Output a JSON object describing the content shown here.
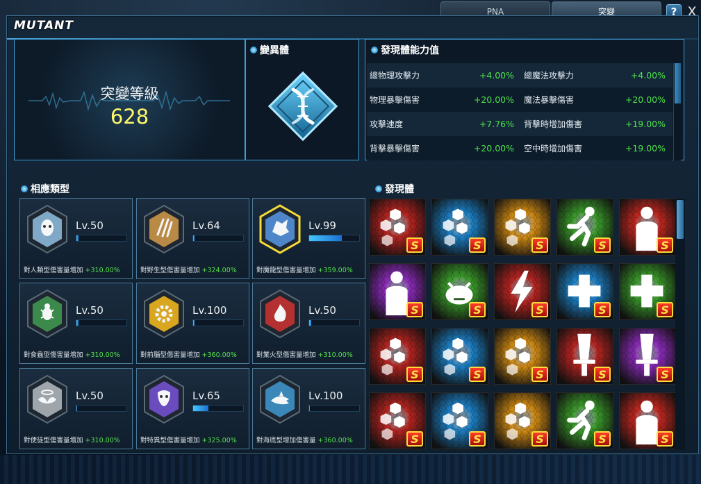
{
  "tabs": [
    {
      "label": "PNA",
      "active": false
    },
    {
      "label": "突變",
      "active": true
    }
  ],
  "help_label": "?",
  "close_label": "X",
  "window_title": "MUTANT",
  "level": {
    "label": "突變等級",
    "value": "628"
  },
  "mutant_header": "變異體",
  "stats_header": "發現體能力值",
  "stats": [
    {
      "left_name": "總物理攻擊力",
      "left_value": "+4.00%",
      "right_name": "總魔法攻擊力",
      "right_value": "+4.00%"
    },
    {
      "left_name": "物理暴擊傷害",
      "left_value": "+20.00%",
      "right_name": "魔法暴擊傷害",
      "right_value": "+20.00%"
    },
    {
      "left_name": "攻擊速度",
      "left_value": "+7.76%",
      "right_name": "背擊時增加傷害",
      "right_value": "+19.00%"
    },
    {
      "left_name": "背擊暴擊傷害",
      "left_value": "+20.00%",
      "right_name": "空中時增加傷害",
      "right_value": "+19.00%"
    }
  ],
  "affinity_header": "相應類型",
  "affinity": [
    {
      "icon": "humanoid-mask-icon",
      "color": "#7fa9c6",
      "level": "Lv.50",
      "progress": 0.04,
      "text": "對人類型傷害量增加",
      "pct": "+310.00%"
    },
    {
      "icon": "beast-claw-icon",
      "color": "#b98a45",
      "level": "Lv.64",
      "progress": 0.03,
      "text": "對野生型傷害量增加",
      "pct": "+324.00%"
    },
    {
      "icon": "dragon-head-icon",
      "color": "#4f86c9",
      "level": "Lv.99",
      "progress": 0.65,
      "text": "對魔龍型傷害量增加",
      "pct": "+359.00%"
    },
    {
      "icon": "insect-icon",
      "color": "#3b8a4c",
      "level": "Lv.50",
      "progress": 0.04,
      "text": "對食蟲型傷害量增加",
      "pct": "+310.00%"
    },
    {
      "icon": "gear-icon",
      "color": "#d9a620",
      "level": "Lv.100",
      "progress": 0.03,
      "text": "對前腦型傷害量增加",
      "pct": "+360.00%"
    },
    {
      "icon": "fire-icon",
      "color": "#b53030",
      "level": "Lv.50",
      "progress": 0.04,
      "text": "對業火型傷害量增加",
      "pct": "+310.00%"
    },
    {
      "icon": "halo-wings-icon",
      "color": "#9ea5ab",
      "level": "Lv.50",
      "progress": 0.02,
      "text": "對使徒型傷害量增加",
      "pct": "+310.00%"
    },
    {
      "icon": "theater-mask-icon",
      "color": "#6a4cbf",
      "level": "Lv.65",
      "progress": 0.3,
      "text": "對特異型傷害量增加",
      "pct": "+325.00%"
    },
    {
      "icon": "shark-icon",
      "color": "#3a87b8",
      "level": "Lv.100",
      "progress": 0.02,
      "text": "對海底型增加傷害量",
      "pct": "+360.00%"
    }
  ],
  "discovered_header": "發現體",
  "badge_label": "S",
  "icon_grid": [
    {
      "icon": "hex-cluster-icon",
      "color": "#b52420"
    },
    {
      "icon": "hex-cluster-icon",
      "color": "#1c7fc4"
    },
    {
      "icon": "hex-cluster-icon",
      "color": "#d08a13"
    },
    {
      "icon": "running-figure-icon",
      "color": "#3a9a2a"
    },
    {
      "icon": "standing-figure-icon",
      "color": "#c0271f"
    },
    {
      "icon": "standing-figure-icon",
      "color": "#8a2bb8"
    },
    {
      "icon": "angry-face-icon",
      "color": "#3a9a2a"
    },
    {
      "icon": "lightning-icon",
      "color": "#b52420"
    },
    {
      "icon": "plus-icon",
      "color": "#1c7fc4"
    },
    {
      "icon": "plus-icon",
      "color": "#3a9a2a"
    },
    {
      "icon": "hex-cluster-icon",
      "color": "#b52420"
    },
    {
      "icon": "hex-cluster-icon",
      "color": "#1c7fc4"
    },
    {
      "icon": "hex-cluster-icon",
      "color": "#d08a13"
    },
    {
      "icon": "sword-icon",
      "color": "#b52420"
    },
    {
      "icon": "sword-icon",
      "color": "#8a2bb8"
    },
    {
      "icon": "hex-cluster-icon",
      "color": "#b52420"
    },
    {
      "icon": "hex-cluster-icon",
      "color": "#1c7fc4"
    },
    {
      "icon": "hex-cluster-icon",
      "color": "#d08a13"
    },
    {
      "icon": "running-figure-icon",
      "color": "#3a9a2a"
    },
    {
      "icon": "standing-figure-icon",
      "color": "#c0271f"
    }
  ]
}
